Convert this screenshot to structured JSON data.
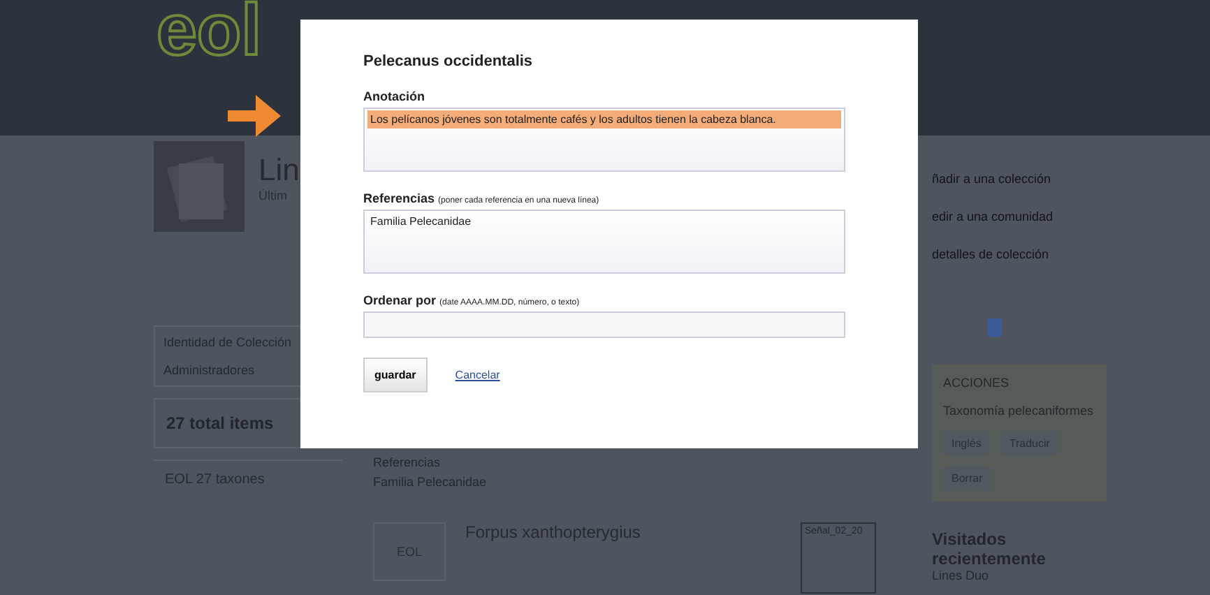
{
  "header": {
    "logo": "eol"
  },
  "page": {
    "title": "Lin",
    "subtitle": "Últim"
  },
  "sidebar": {
    "items": [
      "Identidad de Colección",
      "Administradores"
    ],
    "total": "27 total items",
    "taxa": "EOL 27 taxones"
  },
  "collection_item": {
    "references_label": "Referencias",
    "reference": "Familia Pelecanidae",
    "name": "Forpus xanthopterygius",
    "thumb": "EOL",
    "tag": "Señal_02_20"
  },
  "actions": {
    "links": [
      "ñadir a una colección",
      "edir a una comunidad",
      "detalles de colección"
    ],
    "panel_title": "ACCIONES",
    "panel_item": "Taxonomía pelecaniformes",
    "buttons": [
      "Inglés",
      "Traducir",
      "Borrar"
    ]
  },
  "recent": {
    "title": "Visitados recientemente",
    "item": "Lines Duo"
  },
  "dialog": {
    "title": "Pelecanus occidentalis",
    "fields": [
      {
        "kind": "textarea",
        "label": "Anotación",
        "value": "Los pelícanos jóvenes son totalmente cafés y los adultos tienen la cabeza blanca.",
        "highlighted": true
      },
      {
        "kind": "textarea",
        "label": "Referencias",
        "note": "(poner cada referencia en una nueva línea)",
        "value": "Familia Pelecanidae",
        "highlighted": false
      },
      {
        "kind": "input",
        "label": "Ordenar por",
        "note": "(date AAAA.MM.DD, número, o texto)",
        "highlighted": false
      }
    ],
    "save": "guardar",
    "cancel": "Cancelar"
  }
}
